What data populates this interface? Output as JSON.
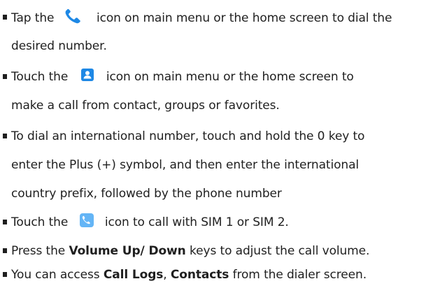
{
  "items": [
    {
      "pre": "Tap the",
      "icon": "phone-handset-icon",
      "post": "icon on main menu or the home screen to dial the",
      "cont": "desired number."
    },
    {
      "pre": "Touch the",
      "icon": "contacts-icon",
      "post": "icon on main menu or the home screen to",
      "cont": "make a call from contact, groups or favorites."
    },
    {
      "line1": "To dial an international number, touch and hold the 0 key to",
      "line2": "enter the Plus (+) symbol, and then enter the international",
      "line3": "country prefix, followed by the phone number"
    },
    {
      "pre": "Touch the",
      "icon": "dialer-app-icon",
      "post": "icon to call with SIM 1 or SIM 2."
    },
    {
      "pre": "Press the",
      "bold": "Volume Up/ Down",
      "post": "keys to adjust the call volume."
    },
    {
      "pre": "You can access",
      "bold1": "Call Logs",
      "mid": ",",
      "bold2": "Contacts",
      "post": "from the dialer screen."
    }
  ],
  "colors": {
    "text": "#1f1f1f",
    "phone_icon": "#1e88e5",
    "contacts_icon": "#1e88e5",
    "dialer_icon_bg": "#64b5f6"
  }
}
